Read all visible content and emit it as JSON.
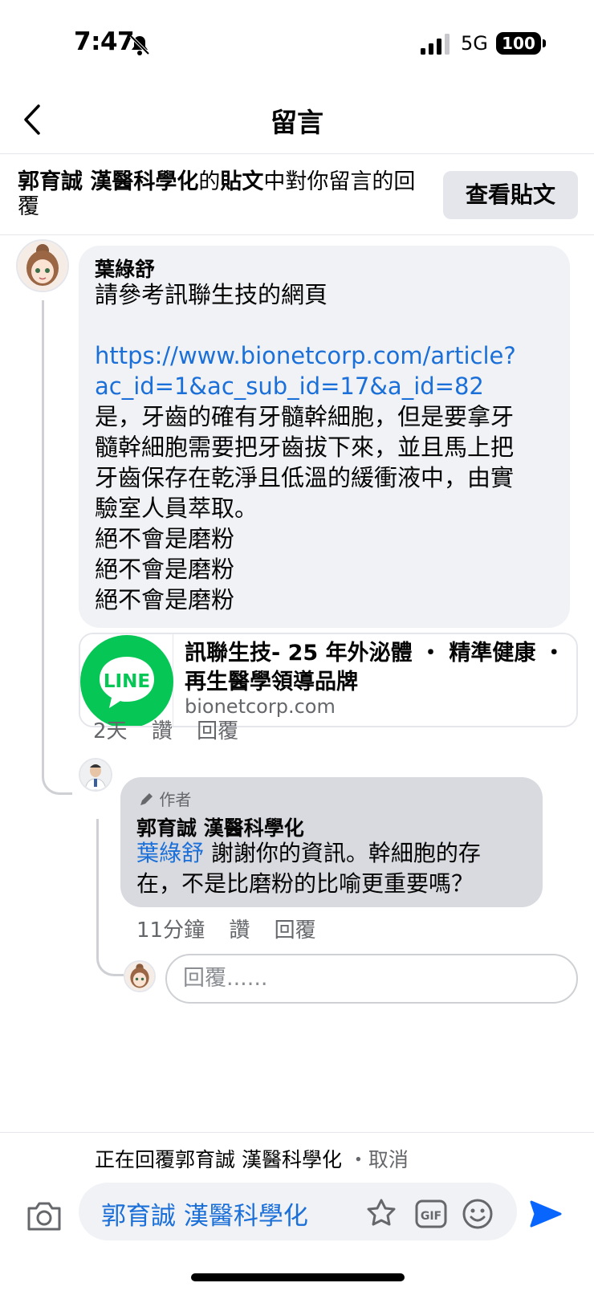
{
  "status": {
    "time": "7:47",
    "network": "5G",
    "battery": "100"
  },
  "nav": {
    "title": "留言"
  },
  "context": {
    "name": "郭育誠 漢醫科學化",
    "mid": "的",
    "post_word": "貼文",
    "suffix": "中對你留言的回覆",
    "view_post_label": "查看貼文"
  },
  "comment": {
    "author": "葉綠舒",
    "line1": "請參考訊聯生技的網頁",
    "link_line1": "https://www.bionetcorp.com/article?",
    "link_line2": "ac_id=1&ac_sub_id=17&a_id=82",
    "body_lines": [
      "是，牙齒的確有牙髓幹細胞，但是要拿牙",
      "髓幹細胞需要把牙齒拔下來，並且馬上把",
      "牙齒保存在乾淨且低溫的緩衝液中，由實",
      "驗室人員萃取。",
      "絕不會是磨粉",
      "絕不會是磨粉",
      "絕不會是磨粉"
    ],
    "card": {
      "logo_text": "LINE",
      "title": "訊聯生技- 25 年外泌體 ・ 精準健康 ・ 再生醫學領導品牌",
      "domain": "bionetcorp.com"
    },
    "time": "2天",
    "like": "讚",
    "reply": "回覆"
  },
  "reply": {
    "badge": "作者",
    "author": "郭育誠 漢醫科學化",
    "mention": "葉綠舒",
    "text_line1": " 謝謝你的資訊。幹細胞的存",
    "text_line2": "在，不是比磨粉的比喻更重要嗎？",
    "time": "11分鐘",
    "like": "讚",
    "reply": "回覆"
  },
  "reply_box": {
    "placeholder": "回覆......"
  },
  "composer": {
    "replying_to": "正在回覆郭育誠 漢醫科學化",
    "cancel": "・取消",
    "text": "郭育誠 漢醫科學化"
  },
  "colors": {
    "link": "#1a6fd8",
    "send": "#0866ff",
    "line_green": "#06c755"
  }
}
